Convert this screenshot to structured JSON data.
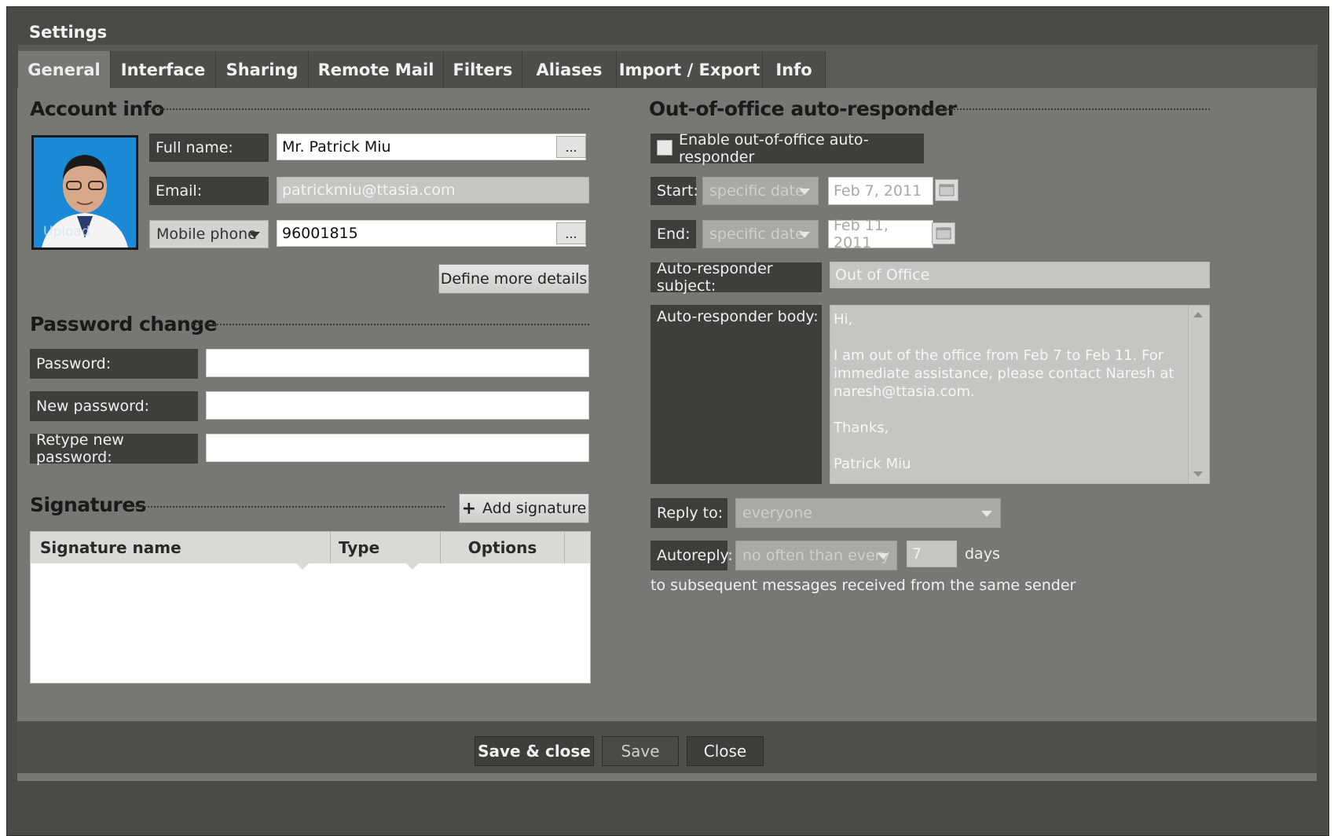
{
  "window": {
    "title": "Settings"
  },
  "tabs": [
    "General",
    "Interface",
    "Sharing",
    "Remote Mail",
    "Filters",
    "Aliases",
    "Import / Export",
    "Info"
  ],
  "account": {
    "section_title": "Account info",
    "photo_overlay": "Upload",
    "full_name_label": "Full name:",
    "full_name_value": "Mr. Patrick Miu",
    "email_label": "Email:",
    "email_value": "patrickmiu@ttasia.com",
    "phone_type": "Mobile phone",
    "phone_value": "96001815",
    "more_btn": "...",
    "define_more": "Define more details"
  },
  "password": {
    "section_title": "Password change",
    "password_label": "Password:",
    "new_password_label": "New password:",
    "retype_label": "Retype new password:"
  },
  "signatures": {
    "section_title": "Signatures",
    "add_btn": "Add signature",
    "add_icon": "plus-icon",
    "columns": [
      "Signature name",
      "Type",
      "Options"
    ],
    "rows": []
  },
  "ooo": {
    "section_title": "Out-of-office auto-responder",
    "enable_label": "Enable out-of-office auto-responder",
    "enabled": false,
    "start_label": "Start:",
    "start_mode": "specific date",
    "start_date": "Feb 7, 2011",
    "end_label": "End:",
    "end_mode": "specific date",
    "end_date": "Feb 11, 2011",
    "subject_label": "Auto-responder subject:",
    "subject_value": "Out of Office",
    "body_label": "Auto-responder body:",
    "body_lines": [
      "Hi,",
      "",
      "I am out of the office from Feb 7 to Feb 11. For",
      "immediate assistance, please contact Naresh at",
      "naresh@ttasia.com.",
      "",
      "Thanks,",
      "",
      "Patrick Miu"
    ],
    "reply_to_label": "Reply to:",
    "reply_to_value": "everyone",
    "autoreply_label": "Autoreply:",
    "autoreply_mode": "no often than every",
    "autoreply_days": "7",
    "days_label": "days",
    "subsequent_note": "to subsequent messages received from the same sender"
  },
  "footer": {
    "save_close": "Save & close",
    "save": "Save",
    "close": "Close"
  }
}
